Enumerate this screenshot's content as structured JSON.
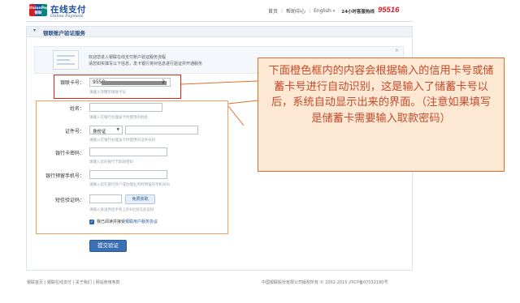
{
  "header": {
    "logo_text": "UnionPay 银联",
    "brand_cn": "在线支付",
    "brand_en": "Online Payment",
    "nav": {
      "home": "首页",
      "help": "帮助中心",
      "language": "English",
      "hotline_label": "24小时客服热线",
      "hotline_number": "95516"
    }
  },
  "section": {
    "title": "银联账户验证服务"
  },
  "notice": {
    "line1": "欢迎您进入银联在线支付账户验证服务流程",
    "line2": "请您如实填写以下信息，发卡银行将对信息进行验证并开通服务",
    "close": "×"
  },
  "form": {
    "card": {
      "label": "银联卡号：",
      "value_prefix": "9550",
      "value_suffix": "2",
      "hint": "请输入完整的银联卡号"
    },
    "name": {
      "label": "姓名：",
      "value": "",
      "hint": "请输入在银行办理该卡时使用的姓名"
    },
    "id": {
      "label": "证件号：",
      "type": "身份证",
      "value": "",
      "hint": "请输入在银行办理该卡时使用的证件号码"
    },
    "password": {
      "label": "银行卡密码：",
      "value": "",
      "hint": "请输入您的银行卡取款密码"
    },
    "phone": {
      "label": "银行预留手机号：",
      "value": "",
      "hint": "请输入您在银行开户或办理业务时预留的手机号码"
    },
    "sms": {
      "label": "短信验证码：",
      "value": "",
      "button": "免费获取",
      "hint": "请输入发送到您手机上的6位短信验证码"
    },
    "agree": {
      "text": "我已阅读并接受",
      "link": "银联用户服务协议"
    },
    "submit": "提交验证"
  },
  "annotation": {
    "text": "下面橙色框内的内容会根据输入的信用卡号或储蓄卡号进行自动识别，这是输入了储蓄卡号以后，系统自动显示出来的界面。（注意如果填写是储蓄卡需要输入取款密码）"
  },
  "footer": {
    "left": "银联首页 | 银联在线支付 | 关于我们 | 网站使用条款",
    "right": "中国银联股份有限公司版权所有 © 2002-2015  沪ICP备07032180号"
  },
  "colors": {
    "brand_blue": "#1c4f9c",
    "hotline_red": "#d71c24",
    "card_box": "#d9261c",
    "orange_box": "#f0a060",
    "annotation_border": "#e06f2c",
    "annotation_bg": "#fde8d4",
    "annotation_text": "#c54c2c",
    "submit_bg": "#3a6fb3"
  }
}
